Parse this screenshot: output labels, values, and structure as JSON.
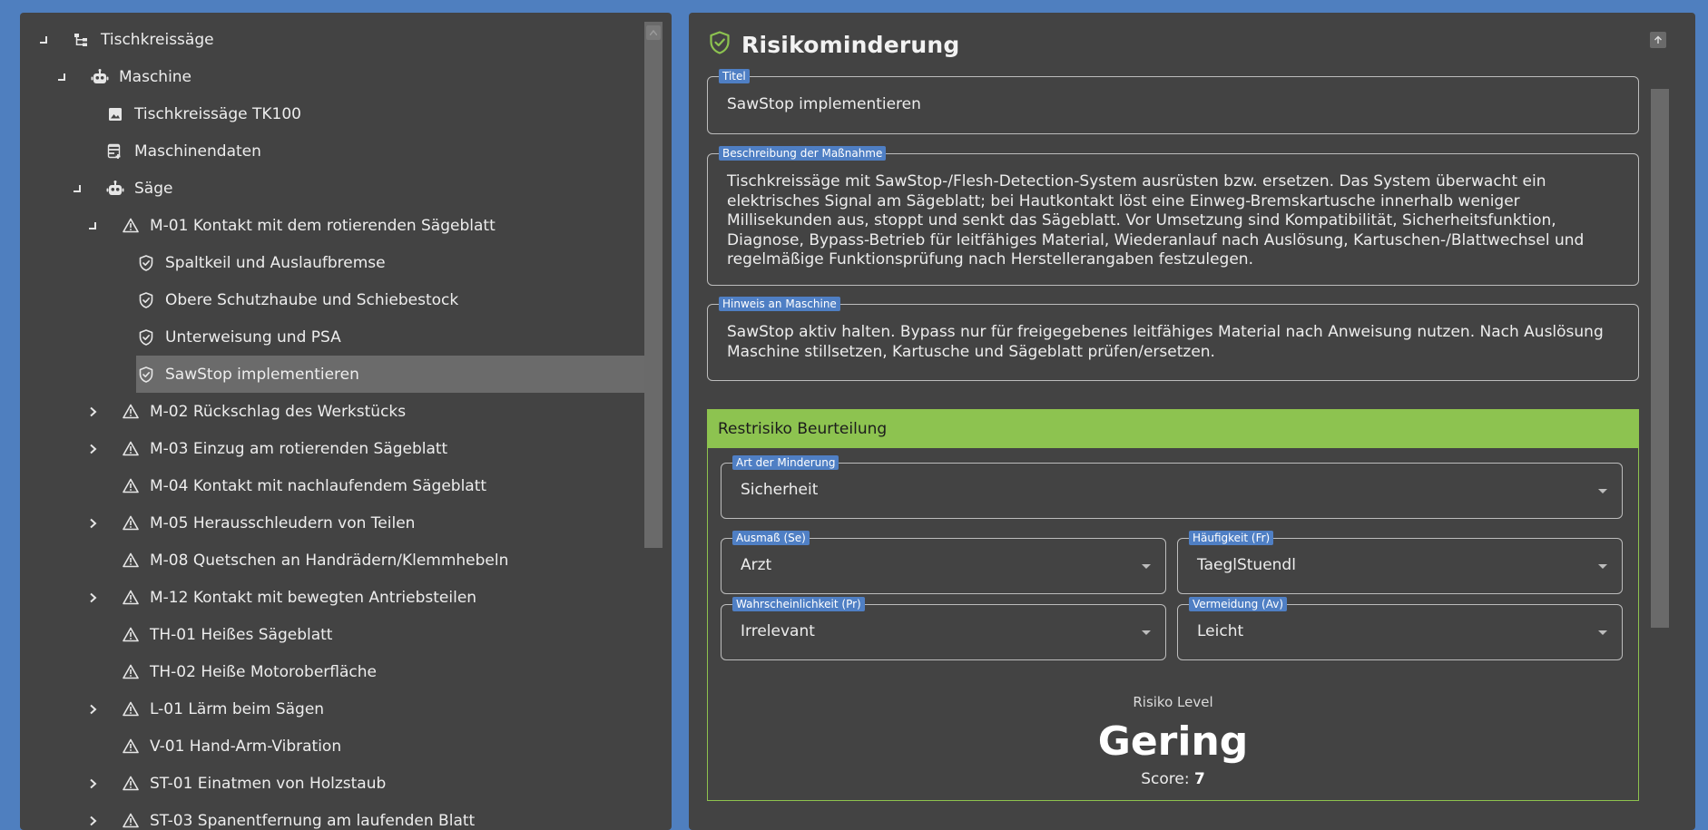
{
  "tree": {
    "items": [
      {
        "label": "Tischkreissäge",
        "icon": "hierarchy-icon",
        "twisty": "expanded"
      },
      {
        "label": "Maschine",
        "icon": "robot-icon",
        "twisty": "expanded"
      },
      {
        "label": "Tischkreissäge TK100",
        "icon": "image-icon",
        "twisty": "none"
      },
      {
        "label": "Maschinendaten",
        "icon": "data-list-icon",
        "twisty": "none"
      },
      {
        "label": "Säge",
        "icon": "robot-icon",
        "twisty": "expanded"
      },
      {
        "label": "M-01 Kontakt mit dem rotierenden Sägeblatt",
        "icon": "warning-icon",
        "twisty": "expanded"
      },
      {
        "label": "Spaltkeil und Auslaufbremse",
        "icon": "shield-check-icon",
        "twisty": "none"
      },
      {
        "label": "Obere Schutzhaube und Schiebestock",
        "icon": "shield-check-icon",
        "twisty": "none"
      },
      {
        "label": "Unterweisung und PSA",
        "icon": "shield-check-icon",
        "twisty": "none"
      },
      {
        "label": "SawStop implementieren",
        "icon": "shield-check-icon",
        "twisty": "none",
        "selected": true
      },
      {
        "label": "M-02 Rückschlag des Werkstücks",
        "icon": "warning-icon",
        "twisty": "collapsed"
      },
      {
        "label": "M-03 Einzug am rotierenden Sägeblatt",
        "icon": "warning-icon",
        "twisty": "collapsed"
      },
      {
        "label": "M-04 Kontakt mit nachlaufendem Sägeblatt",
        "icon": "warning-icon",
        "twisty": "none"
      },
      {
        "label": "M-05 Herausschleudern von Teilen",
        "icon": "warning-icon",
        "twisty": "collapsed"
      },
      {
        "label": "M-08 Quetschen an Handrädern/Klemmhebeln",
        "icon": "warning-icon",
        "twisty": "none"
      },
      {
        "label": "M-12 Kontakt mit bewegten Antriebsteilen",
        "icon": "warning-icon",
        "twisty": "collapsed"
      },
      {
        "label": "TH-01 Heißes Sägeblatt",
        "icon": "warning-icon",
        "twisty": "none"
      },
      {
        "label": "TH-02 Heiße Motoroberfläche",
        "icon": "warning-icon",
        "twisty": "none"
      },
      {
        "label": "L-01 Lärm beim Sägen",
        "icon": "warning-icon",
        "twisty": "collapsed"
      },
      {
        "label": "V-01 Hand-Arm-Vibration",
        "icon": "warning-icon",
        "twisty": "none"
      },
      {
        "label": "ST-01 Einatmen von Holzstaub",
        "icon": "warning-icon",
        "twisty": "collapsed"
      },
      {
        "label": "ST-03 Spanentfernung am laufenden Blatt",
        "icon": "warning-icon",
        "twisty": "collapsed"
      }
    ]
  },
  "detail": {
    "title": "Risikominderung",
    "titel_label": "Titel",
    "titel_value": "SawStop implementieren",
    "beschreibung_label": "Beschreibung der Maßnahme",
    "beschreibung_value": "Tischkreissäge mit SawStop-/Flesh-Detection-System ausrüsten bzw. ersetzen. Das System überwacht ein elektrisches Signal am Sägeblatt; bei Hautkontakt löst eine Einweg-Bremskartusche innerhalb weniger Millisekunden aus, stoppt und senkt das Sägeblatt. Vor Umsetzung sind Kompatibilität, Sicherheitsfunktion, Diagnose, Bypass-Betrieb für leitfähiges Material, Wiederanlauf nach Auslösung, Kartuschen-/Blattwechsel und regelmäßige Funktionsprüfung nach Herstellerangaben festzulegen.",
    "hinweis_label": "Hinweis an Maschine",
    "hinweis_value": "SawStop aktiv halten. Bypass nur für freigegebenes leitfähiges Material nach Anweisung nutzen. Nach Auslösung Maschine stillsetzen, Kartusche und Sägeblatt prüfen/ersetzen."
  },
  "restrisiko": {
    "header": "Restrisiko Beurteilung",
    "art_label": "Art der Minderung",
    "art_value": "Sicherheit",
    "ausmass_label": "Ausmaß (Se)",
    "ausmass_value": "Arzt",
    "haeufigkeit_label": "Häufigkeit (Fr)",
    "haeufigkeit_value": "TaeglStuendl",
    "wahrscheinlichkeit_label": "Wahrscheinlichkeit (Pr)",
    "wahrscheinlichkeit_value": "Irrelevant",
    "vermeidung_label": "Vermeidung (Av)",
    "vermeidung_value": "Leicht",
    "level_label": "Risiko Level",
    "level_value": "Gering",
    "score_label": "Score:",
    "score_value": "7"
  },
  "colors": {
    "background": "#4f7fbf",
    "panel": "#434343",
    "selected_row": "#6b6b6b",
    "legend": "#4f7fc4",
    "risk_green": "#8dc350"
  }
}
